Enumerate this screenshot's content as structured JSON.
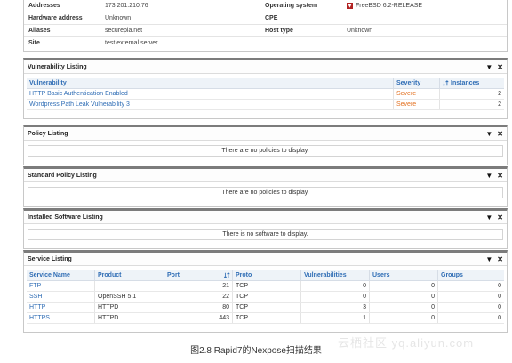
{
  "host": {
    "rows": [
      {
        "k1": "Addresses",
        "v1": "173.201.210.76",
        "k2": "Operating system",
        "v2": "FreeBSD 6.2-RELEASE"
      },
      {
        "k1": "Hardware address",
        "v1": "Unknown",
        "k2": "CPE",
        "v2": ""
      },
      {
        "k1": "Aliases",
        "v1": "securepla.net",
        "k2": "Host type",
        "v2": "Unknown"
      },
      {
        "k1": "Site",
        "v1": "test external server",
        "k2": "",
        "v2": ""
      }
    ]
  },
  "panel_controls": {
    "collapse": "▼",
    "close": "✕"
  },
  "vulnerability": {
    "title": "Vulnerability Listing",
    "headers": {
      "vulnerability": "Vulnerability",
      "severity": "Severity",
      "instances": "Instances"
    },
    "rows": [
      {
        "name": "HTTP Basic Authentication Enabled",
        "severity": "Severe",
        "instances": "2"
      },
      {
        "name": "Wordpress Path Leak Vulnerability 3",
        "severity": "Severe",
        "instances": "2"
      }
    ]
  },
  "policy": {
    "title": "Policy Listing",
    "empty": "There are no policies to display."
  },
  "standard_policy": {
    "title": "Standard Policy Listing",
    "empty": "There are no policies to display."
  },
  "software": {
    "title": "Installed Software Listing",
    "empty": "There is no software to display."
  },
  "service": {
    "title": "Service Listing",
    "headers": {
      "name": "Service Name",
      "product": "Product",
      "port": "Port",
      "proto": "Proto",
      "vulns": "Vulnerabilities",
      "users": "Users",
      "groups": "Groups"
    },
    "rows": [
      {
        "name": "FTP",
        "product": "",
        "port": "21",
        "proto": "TCP",
        "vulns": "0",
        "users": "0",
        "groups": "0"
      },
      {
        "name": "SSH",
        "product": "OpenSSH 5.1",
        "port": "22",
        "proto": "TCP",
        "vulns": "0",
        "users": "0",
        "groups": "0"
      },
      {
        "name": "HTTP",
        "product": "HTTPD",
        "port": "80",
        "proto": "TCP",
        "vulns": "3",
        "users": "0",
        "groups": "0"
      },
      {
        "name": "HTTPS",
        "product": "HTTPD",
        "port": "443",
        "proto": "TCP",
        "vulns": "1",
        "users": "0",
        "groups": "0"
      }
    ]
  },
  "caption": "图2.8 Rapid7的Nexpose扫描结果",
  "watermark": "云栖社区 yq.aliyun.com",
  "colors": {
    "link": "#2f6db5",
    "severe": "#e37222",
    "panel_border": "#7c7c7c"
  }
}
